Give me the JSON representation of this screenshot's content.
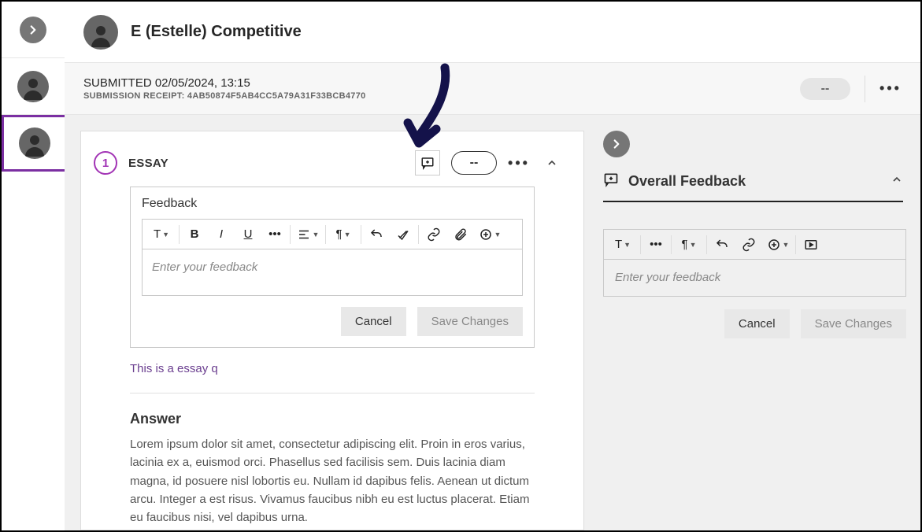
{
  "header": {
    "student_name": "E (Estelle) Competitive"
  },
  "subheader": {
    "submitted": "SUBMITTED 02/05/2024, 13:15",
    "receipt": "SUBMISSION RECEIPT: 4AB50874F5AB4CC5A79A31F33BCB4770",
    "grade_placeholder": "--"
  },
  "question": {
    "number": "1",
    "type": "ESSAY",
    "score_placeholder": "--",
    "feedback_label": "Feedback",
    "feedback_placeholder": "Enter your feedback",
    "cancel": "Cancel",
    "save": "Save Changes",
    "prompt": "This is a essay q",
    "answer_heading": "Answer",
    "answer_body": "Lorem ipsum dolor sit amet, consectetur adipiscing elit. Proin in eros varius, lacinia ex a, euismod orci. Phasellus sed facilisis sem. Duis lacinia diam magna, id posuere nisl lobortis eu. Nullam id dapibus felis. Aenean ut dictum arcu. Integer a est risus. Vivamus faucibus nibh eu est luctus placerat. Etiam eu faucibus nisi, vel dapibus urna."
  },
  "overall_feedback": {
    "title": "Overall Feedback",
    "placeholder": "Enter your feedback",
    "cancel": "Cancel",
    "save": "Save Changes"
  }
}
